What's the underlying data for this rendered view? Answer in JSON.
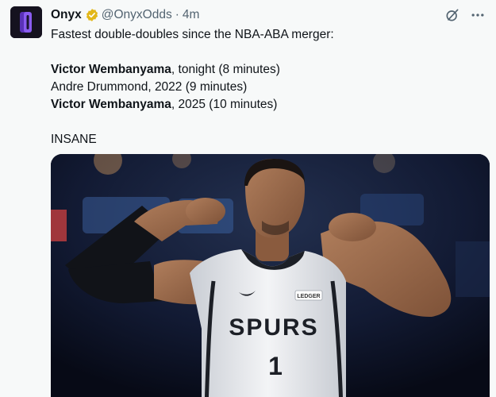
{
  "author": {
    "name": "Onyx",
    "handle": "@OnyxOdds",
    "separator": "·",
    "time": "4m"
  },
  "tweet": {
    "line1": "Fastest double-doubles since the NBA-ABA merger:",
    "entries": [
      {
        "player": "Victor Wembanyama",
        "detail": ", tonight (8 minutes)",
        "bold": true
      },
      {
        "player": "Andre Drummond",
        "detail": ", 2022 (9 minutes)",
        "bold": false
      },
      {
        "player": "Victor Wembanyama",
        "detail": ", 2025 (10 minutes)",
        "bold": true
      }
    ],
    "closing": "INSANE"
  },
  "media": {
    "jersey_team": "SPURS",
    "jersey_number": "1",
    "jersey_patch": "LEDGER"
  },
  "icons": {
    "avatar": "onyx-logo-icon",
    "verified": "verified-badge-icon",
    "grok": "grok-icon",
    "more": "more-icon"
  },
  "colors": {
    "verified_gold": "#e2b719",
    "logo_purple": "#7b4ce0",
    "background": "#f7f9f9"
  }
}
